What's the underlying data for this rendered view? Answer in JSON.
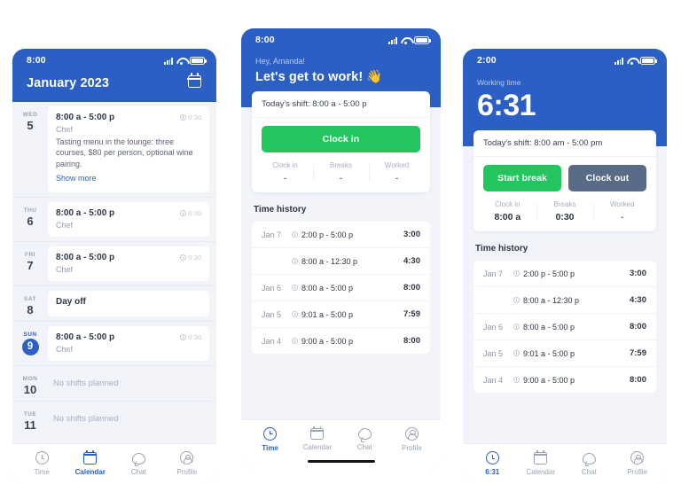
{
  "phone_calendar": {
    "status_bar": {
      "time": "8:00",
      "signal_icon": "signal-icon",
      "wifi_icon": "wifi-icon",
      "battery_icon": "battery-icon"
    },
    "header": {
      "title": "January 2023",
      "action_icon": "calendar-icon"
    },
    "days": [
      {
        "dow": "WED",
        "num": "5",
        "today": false,
        "type": "shift",
        "time": "8:00 a - 5:00 p",
        "duration": "0:30",
        "role": "Chef",
        "note": "Tasting menu in the lounge: three courses, $80 per person, optional wine pairing.",
        "more": "Show more"
      },
      {
        "dow": "THU",
        "num": "6",
        "today": false,
        "type": "shift",
        "time": "8:00 a - 5:00 p",
        "duration": "0:30",
        "role": "Chef",
        "note": "",
        "more": ""
      },
      {
        "dow": "FRI",
        "num": "7",
        "today": false,
        "type": "shift",
        "time": "8:00 a - 5:00 p",
        "duration": "0:30",
        "role": "Chef",
        "note": "",
        "more": ""
      },
      {
        "dow": "SAT",
        "num": "8",
        "today": false,
        "type": "dayoff",
        "label": "Day off"
      },
      {
        "dow": "SUN",
        "num": "9",
        "today": true,
        "type": "shift",
        "time": "8:00 a - 5:00 p",
        "duration": "0:30",
        "role": "Chef",
        "note": "",
        "more": ""
      },
      {
        "dow": "MON",
        "num": "10",
        "today": false,
        "type": "none",
        "label": "No shifts planned"
      },
      {
        "dow": "TUE",
        "num": "11",
        "today": false,
        "type": "none",
        "label": "No shifts planned"
      }
    ],
    "tabs": [
      {
        "label": "Time",
        "icon": "clock-icon",
        "active": false
      },
      {
        "label": "Calendar",
        "icon": "calendar-icon",
        "active": true
      },
      {
        "label": "Chat",
        "icon": "chat-icon",
        "active": false
      },
      {
        "label": "Profile",
        "icon": "user-icon",
        "active": false
      }
    ]
  },
  "phone_clockin": {
    "status_bar": {
      "time": "8:00",
      "signal_icon": "signal-icon",
      "wifi_icon": "wifi-icon",
      "battery_icon": "battery-icon"
    },
    "hero": {
      "greeting": "Hey, Amanda!",
      "headline": "Let's get to work! 👋"
    },
    "shift_card": {
      "shift_text": "Today's shift: 8:00 a - 5:00 p",
      "primary_button": "Clock in",
      "stats": [
        {
          "label": "Clock in",
          "value": "-"
        },
        {
          "label": "Breaks",
          "value": "-"
        },
        {
          "label": "Worked",
          "value": "-"
        }
      ]
    },
    "history": {
      "title": "Time history",
      "rows": [
        {
          "date": "Jan 7",
          "span": "2:00 p - 5:00 p",
          "total": "3:00"
        },
        {
          "date": "",
          "span": "8:00 a - 12:30 p",
          "total": "4:30"
        },
        {
          "date": "Jan 6",
          "span": "8:00 a - 5:00 p",
          "total": "8:00"
        },
        {
          "date": "Jan 5",
          "span": "9:01 a - 5:00 p",
          "total": "7:59"
        },
        {
          "date": "Jan 4",
          "span": "9:00 a - 5:00 p",
          "total": "8:00"
        }
      ]
    },
    "tabs": [
      {
        "label": "Time",
        "icon": "clock-icon",
        "active": true
      },
      {
        "label": "Calendar",
        "icon": "calendar-icon",
        "active": false
      },
      {
        "label": "Chat",
        "icon": "chat-icon",
        "active": false
      },
      {
        "label": "Profile",
        "icon": "user-icon",
        "active": false
      }
    ]
  },
  "phone_working": {
    "status_bar": {
      "time": "2:00",
      "signal_icon": "signal-icon",
      "wifi_icon": "wifi-icon",
      "battery_icon": "battery-icon"
    },
    "hero": {
      "label": "Working time",
      "timer": "6:31"
    },
    "shift_card": {
      "shift_text": "Today's shift: 8:00 am - 5:00 pm",
      "break_button": "Start break",
      "clockout_button": "Clock out",
      "stats": [
        {
          "label": "Clock in",
          "value": "8:00 a"
        },
        {
          "label": "Breaks",
          "value": "0:30"
        },
        {
          "label": "Worked",
          "value": "-"
        }
      ]
    },
    "history": {
      "title": "Time history",
      "rows": [
        {
          "date": "Jan 7",
          "span": "2:00 p - 5:00 p",
          "total": "3:00"
        },
        {
          "date": "",
          "span": "8:00 a - 12:30 p",
          "total": "4:30"
        },
        {
          "date": "Jan 6",
          "span": "8:00 a - 5:00 p",
          "total": "8:00"
        },
        {
          "date": "Jan 5",
          "span": "9:01 a - 5:00 p",
          "total": "7:59"
        },
        {
          "date": "Jan 4",
          "span": "9:00 a - 5:00 p",
          "total": "8:00"
        }
      ]
    },
    "tabs": [
      {
        "label": "6:31",
        "icon": "clock-icon",
        "active": true
      },
      {
        "label": "Calendar",
        "icon": "calendar-icon",
        "active": false
      },
      {
        "label": "Chat",
        "icon": "chat-icon",
        "active": false
      },
      {
        "label": "Profile",
        "icon": "user-icon",
        "active": false
      }
    ]
  },
  "colors": {
    "brand_blue": "#2b5fc4",
    "green": "#22c55e",
    "slate": "#5a6b87",
    "bg": "#f2f4fa"
  }
}
